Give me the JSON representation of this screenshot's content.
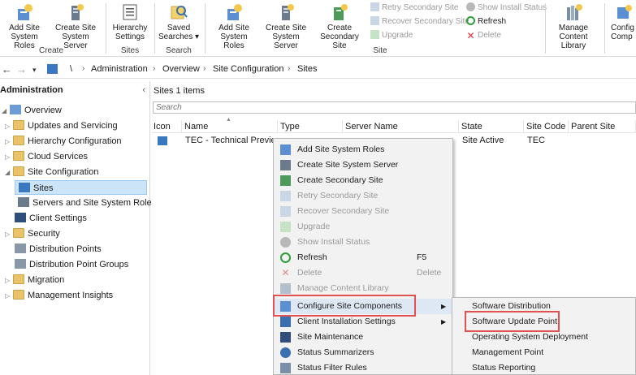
{
  "ribbon": {
    "buttons": [
      {
        "label": "Add Site\nSystem Roles",
        "icon": "add-site-system-roles-icon"
      },
      {
        "label": "Create Site\nSystem Server",
        "icon": "create-site-system-server-icon"
      },
      {
        "label": "Hierarchy\nSettings",
        "icon": "hierarchy-settings-icon"
      },
      {
        "label": "Saved\nSearches ▾",
        "icon": "saved-searches-icon"
      },
      {
        "label": "Add Site\nSystem Roles",
        "icon": "add-site-system-roles-icon"
      },
      {
        "label": "Create Site\nSystem Server",
        "icon": "create-site-system-server-icon"
      },
      {
        "label": "Create\nSecondary Site",
        "icon": "create-secondary-site-icon"
      },
      {
        "label": "Manage\nContent Library",
        "icon": "manage-content-library-icon"
      },
      {
        "label": "Config\nComp",
        "icon": "configure-components-icon"
      }
    ],
    "small_buttons": [
      {
        "label": "Retry Secondary Site",
        "enabled": false
      },
      {
        "label": "Recover Secondary Site",
        "enabled": false
      },
      {
        "label": "Upgrade",
        "enabled": false
      },
      {
        "label": "Show Install Status",
        "enabled": false
      },
      {
        "label": "Refresh",
        "enabled": true
      },
      {
        "label": "Delete",
        "enabled": false
      }
    ],
    "groups": [
      "Create",
      "Sites",
      "Search",
      "Site"
    ]
  },
  "address": {
    "crumbs": [
      "\\",
      "Administration",
      "Overview",
      "Site Configuration",
      "Sites"
    ]
  },
  "nav": {
    "title": "Administration",
    "items": [
      {
        "label": "Overview",
        "level": 0
      },
      {
        "label": "Updates and Servicing",
        "level": 1
      },
      {
        "label": "Hierarchy Configuration",
        "level": 1
      },
      {
        "label": "Cloud Services",
        "level": 1
      },
      {
        "label": "Site Configuration",
        "level": 1
      },
      {
        "label": "Sites",
        "level": 2,
        "selected": true
      },
      {
        "label": "Servers and Site System Roles",
        "level": 2
      },
      {
        "label": "Client Settings",
        "level": 1
      },
      {
        "label": "Security",
        "level": 1
      },
      {
        "label": "Distribution Points",
        "level": 1
      },
      {
        "label": "Distribution Point Groups",
        "level": 1
      },
      {
        "label": "Migration",
        "level": 1
      },
      {
        "label": "Management Insights",
        "level": 1
      }
    ]
  },
  "main": {
    "title": "Sites 1 items",
    "search_placeholder": "Search",
    "columns": [
      "Icon",
      "Name",
      "Type",
      "Server Name",
      "State",
      "Site Code",
      "Parent Site Code"
    ],
    "rows": [
      {
        "name": "TEC - Technical Preview...",
        "type": "",
        "server": "",
        "state": "Site Active",
        "code": "TEC",
        "parent": ""
      }
    ]
  },
  "context_menu": {
    "items": [
      {
        "label": "Add Site System Roles",
        "shortcut": "",
        "enabled": true,
        "icon": "add-roles-icon"
      },
      {
        "label": "Create Site System Server",
        "shortcut": "",
        "enabled": true,
        "icon": "create-server-icon"
      },
      {
        "label": "Create Secondary Site",
        "shortcut": "",
        "enabled": true,
        "icon": "secondary-site-icon"
      },
      {
        "label": "Retry Secondary Site",
        "shortcut": "",
        "enabled": false,
        "icon": "retry-icon"
      },
      {
        "label": "Recover Secondary Site",
        "shortcut": "",
        "enabled": false,
        "icon": "recover-icon"
      },
      {
        "label": "Upgrade",
        "shortcut": "",
        "enabled": false,
        "icon": "upgrade-icon"
      },
      {
        "label": "Show Install Status",
        "shortcut": "",
        "enabled": false,
        "icon": "info-icon"
      },
      {
        "label": "Refresh",
        "shortcut": "F5",
        "enabled": true,
        "icon": "refresh-icon"
      },
      {
        "label": "Delete",
        "shortcut": "Delete",
        "enabled": false,
        "icon": "delete-icon"
      },
      {
        "label": "Manage Content Library",
        "shortcut": "",
        "enabled": false,
        "icon": "library-icon"
      },
      {
        "label": "Configure Site Components",
        "shortcut": "",
        "enabled": true,
        "icon": "configure-icon",
        "submenu": true
      },
      {
        "label": "Client Installation Settings",
        "shortcut": "",
        "enabled": true,
        "icon": "client-install-icon",
        "submenu": true
      },
      {
        "label": "Site Maintenance",
        "shortcut": "",
        "enabled": true,
        "icon": "maintenance-icon"
      },
      {
        "label": "Status Summarizers",
        "shortcut": "",
        "enabled": true,
        "icon": "summarizers-icon"
      },
      {
        "label": "Status Filter Rules",
        "shortcut": "",
        "enabled": true,
        "icon": "filter-icon"
      }
    ]
  },
  "submenu": {
    "items": [
      "Software Distribution",
      "Software Update Point",
      "Operating System Deployment",
      "Management Point",
      "Status Reporting"
    ]
  },
  "colors": {
    "selection": "#cce4f7",
    "highlight_box": "#e05252",
    "menu_bg": "#f2f2f2",
    "refresh_green": "#2e9e3a",
    "delete_red": "#d33"
  }
}
